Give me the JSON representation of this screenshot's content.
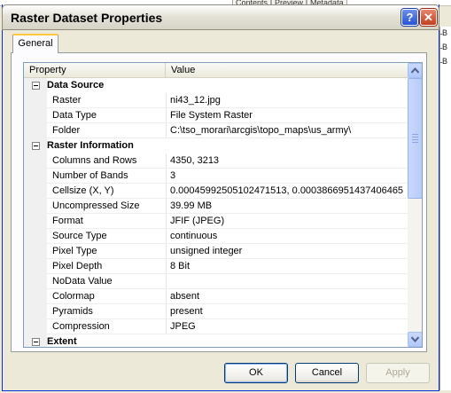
{
  "background_app": {
    "tabs": [
      "Contents",
      "Preview",
      "Metadata"
    ],
    "right_items": [
      "B",
      "B",
      "B"
    ]
  },
  "dialog": {
    "title": "Raster Dataset Properties",
    "help_glyph": "?",
    "close_glyph": "✕"
  },
  "tab": {
    "label": "General"
  },
  "grid": {
    "columns": {
      "property": "Property",
      "value": "Value"
    },
    "rows": [
      {
        "type": "category",
        "name": "Data Source"
      },
      {
        "type": "prop",
        "name": "Raster",
        "value": "ni43_12.jpg"
      },
      {
        "type": "prop",
        "name": "Data Type",
        "value": "File System Raster"
      },
      {
        "type": "prop",
        "name": "Folder",
        "value": "C:\\tso_morari\\arcgis\\topo_maps\\us_army\\"
      },
      {
        "type": "category",
        "name": "Raster Information"
      },
      {
        "type": "prop",
        "name": "Columns and Rows",
        "value": "4350, 3213"
      },
      {
        "type": "prop",
        "name": "Number of Bands",
        "value": "3"
      },
      {
        "type": "prop",
        "name": "Cellsize (X, Y)",
        "value": "0.00045992505102471513, 0.0003866951437406465"
      },
      {
        "type": "prop",
        "name": "Uncompressed Size",
        "value": "39.99 MB"
      },
      {
        "type": "prop",
        "name": "Format",
        "value": "JFIF (JPEG)"
      },
      {
        "type": "prop",
        "name": "Source Type",
        "value": "continuous"
      },
      {
        "type": "prop",
        "name": "Pixel Type",
        "value": "unsigned integer"
      },
      {
        "type": "prop",
        "name": "Pixel Depth",
        "value": "8 Bit"
      },
      {
        "type": "prop",
        "name": "NoData Value",
        "value": ""
      },
      {
        "type": "prop",
        "name": "Colormap",
        "value": "absent"
      },
      {
        "type": "prop",
        "name": "Pyramids",
        "value": "present"
      },
      {
        "type": "prop",
        "name": "Compression",
        "value": "JPEG"
      },
      {
        "type": "category",
        "name": "Extent"
      }
    ]
  },
  "buttons": {
    "ok": "OK",
    "cancel": "Cancel",
    "apply": "Apply"
  },
  "colors": {
    "title_accent": "#0831d9",
    "close_red": "#c43f1f",
    "help_blue": "#2853d3",
    "tab_highlight": "#ffc83c"
  }
}
